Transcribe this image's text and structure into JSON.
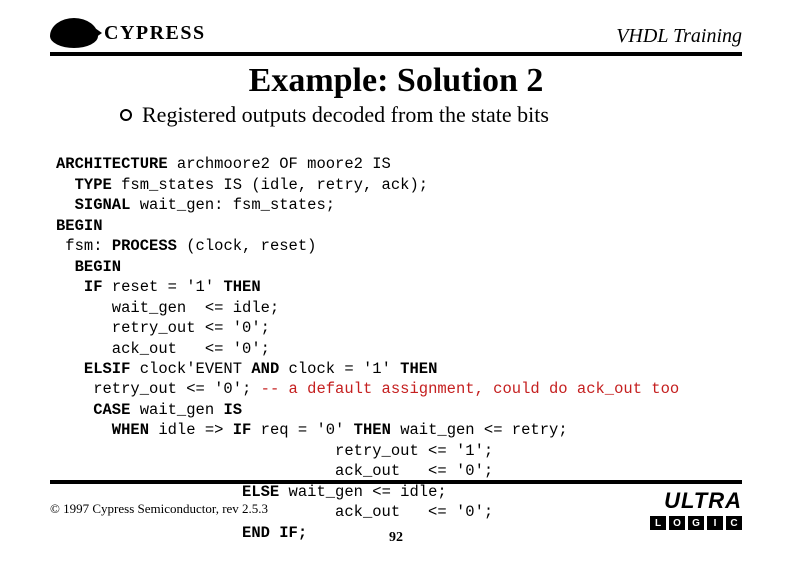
{
  "header": {
    "logo_text": "CYPRESS",
    "title": "VHDL Training"
  },
  "slide": {
    "title": "Example: Solution 2",
    "bullet": "Registered outputs decoded from the state bits"
  },
  "code": {
    "l1a": "ARCHITECTURE",
    "l1b": " archmoore2 OF moore2 IS",
    "l2a": "  TYPE",
    "l2b": " fsm_states IS (idle, retry, ack);",
    "l3a": "  SIGNAL",
    "l3b": " wait_gen: fsm_states;",
    "l4": "BEGIN",
    "l5a": " fsm: ",
    "l5b": "PROCESS",
    "l5c": " (clock, reset)",
    "l6": "  BEGIN",
    "l7a": "   IF",
    "l7b": " reset = '1' ",
    "l7c": "THEN",
    "l8": "      wait_gen  <= idle;",
    "l9": "      retry_out <= '0';",
    "l10": "      ack_out   <= '0';",
    "l11a": "   ELSIF",
    "l11b": " clock'EVENT ",
    "l11c": "AND",
    "l11d": " clock = '1' ",
    "l11e": "THEN",
    "l12a": "    retry_out <= '0'; ",
    "l12b": "-- a default assignment, could do ack_out too",
    "l13a": "    CASE",
    "l13b": " wait_gen ",
    "l13c": "IS",
    "l14a": "      WHEN",
    "l14b": " idle => ",
    "l14c": "IF",
    "l14d": " req = '0' ",
    "l14e": "THEN",
    "l14f": " wait_gen <= retry;",
    "l15": "                              retry_out <= '1';",
    "l16": "                              ack_out   <= '0';",
    "l17a": "                    ",
    "l17b": "ELSE",
    "l17c": " wait_gen <= idle;",
    "l18": "                              ack_out   <= '0';",
    "l19a": "                    ",
    "l19b": "END IF;"
  },
  "footer": {
    "copyright": "© 1997 Cypress Semiconductor, rev 2.5.3",
    "page": "92",
    "ultra": "ULTRA",
    "ultra_letters": [
      "L",
      "O",
      "G",
      "I",
      "C"
    ]
  }
}
